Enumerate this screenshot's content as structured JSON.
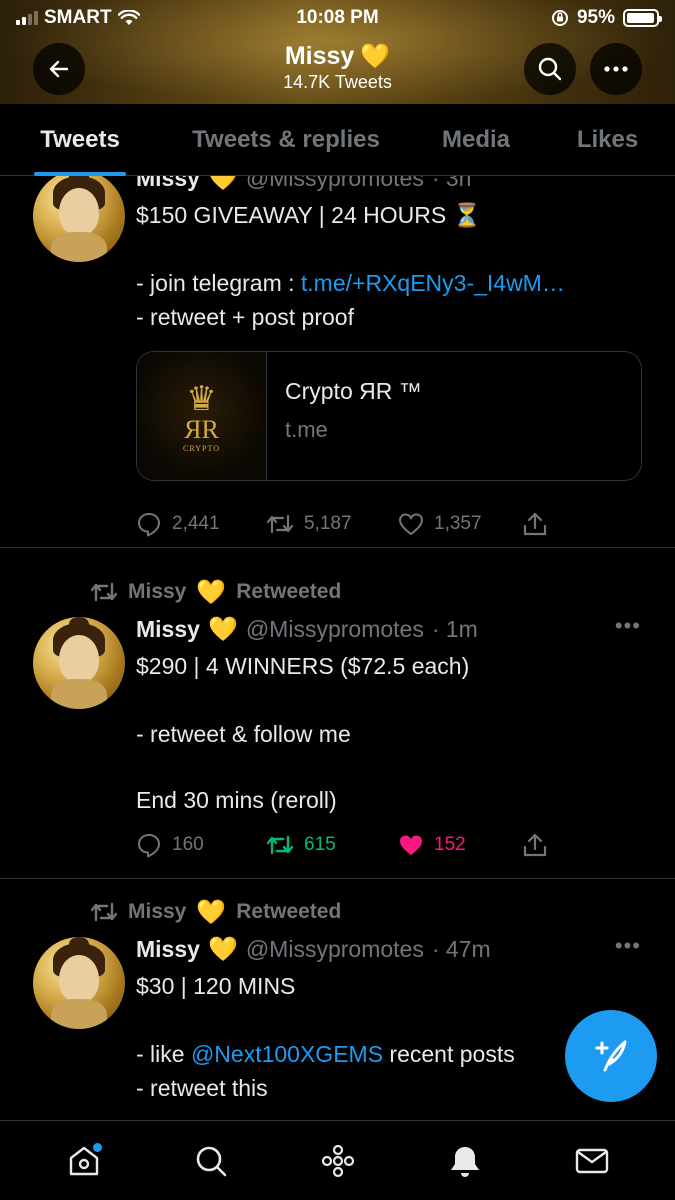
{
  "status_bar": {
    "carrier": "SMART",
    "time": "10:08 PM",
    "battery": "95%"
  },
  "header": {
    "name": "Missy",
    "name_emoji": "💛",
    "tweet_count": "14.7K Tweets"
  },
  "tabs": [
    {
      "label": "Tweets",
      "active": true
    },
    {
      "label": "Tweets & replies",
      "active": false
    },
    {
      "label": "Media",
      "active": false
    },
    {
      "label": "Likes",
      "active": false
    }
  ],
  "tweets": [
    {
      "name": "Missy",
      "emoji": "💛",
      "handle": "@Missypromotes",
      "time": "· 3h",
      "line1": "$150 GIVEAWAY | 24 HOURS",
      "line1_emoji": "⏳",
      "line2_prefix": "- join telegram : ",
      "line2_link": "t.me/+RXqENy3-_I4wM…",
      "line3": "- retweet + post proof",
      "card": {
        "title": "Crypto ЯR ™",
        "domain": "t.me",
        "thumb_text": "ЯR",
        "thumb_sub": "CRYPTO"
      },
      "replies": "2,441",
      "retweets": "5,187",
      "likes": "1,357"
    },
    {
      "retweeted_by": "Missy",
      "retweeted_emoji": "💛",
      "retweeted_label": "Retweeted",
      "name": "Missy",
      "emoji": "💛",
      "handle": "@Missypromotes",
      "time": "· 1m",
      "line1": "$290 | 4 WINNERS ($72.5 each)",
      "line2": "- retweet & follow me",
      "line3": "End 30 mins (reroll)",
      "replies": "160",
      "retweets": "615",
      "likes": "152"
    },
    {
      "retweeted_by": "Missy",
      "retweeted_emoji": "💛",
      "retweeted_label": "Retweeted",
      "name": "Missy",
      "emoji": "💛",
      "handle": "@Missypromotes",
      "time": "· 47m",
      "line1": "$30 | 120 MINS",
      "line2_prefix": "- like ",
      "line2_link": "@Next100XGEMS",
      "line2_suffix": " recent posts",
      "line3": "- retweet this"
    }
  ],
  "colors": {
    "accent": "#1d9bf0",
    "retweet_green": "#00ba7c",
    "like_pink": "#f91880",
    "banner_gold": "#8a6a22"
  },
  "icons": [
    "back-arrow-icon",
    "search-icon",
    "more-icon",
    "reply-icon",
    "retweet-icon",
    "like-icon",
    "share-icon",
    "compose-icon",
    "home-icon",
    "explore-icon",
    "spaces-icon",
    "notifications-icon",
    "messages-icon"
  ]
}
